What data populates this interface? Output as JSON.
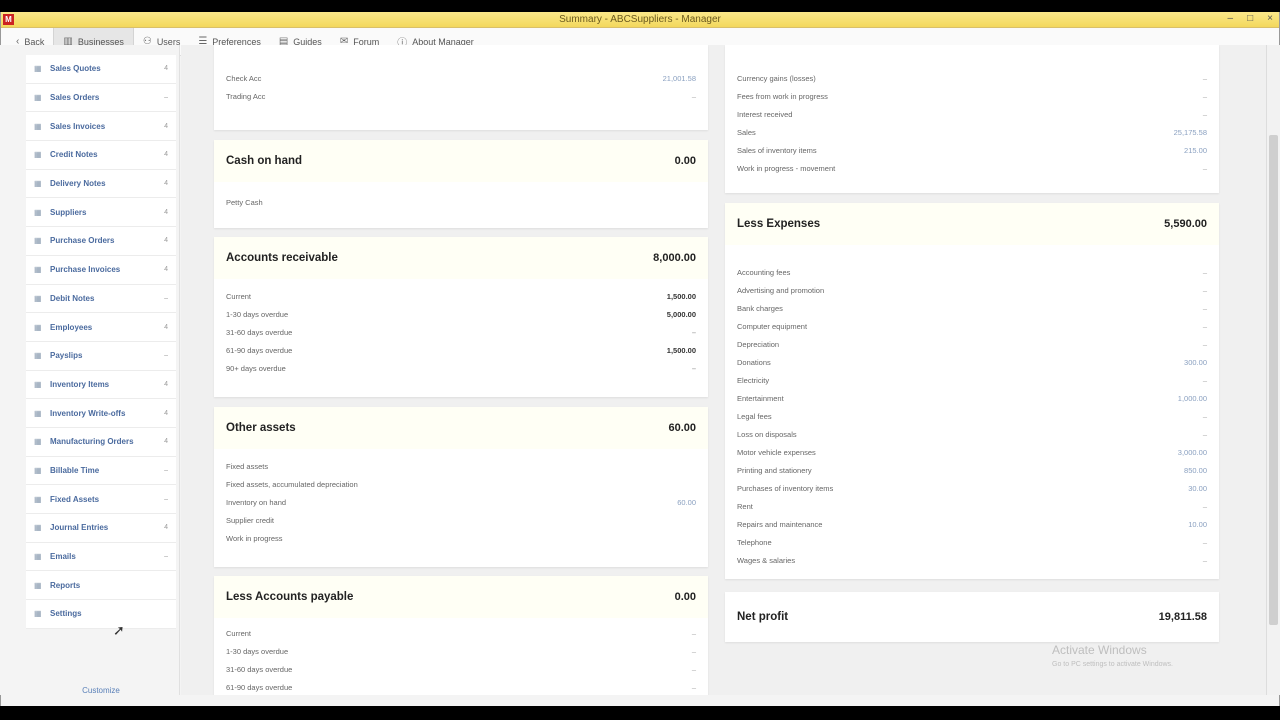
{
  "window": {
    "title": "Summary - ABCSuppliers - Manager",
    "app_icon": "M",
    "controls": [
      "–",
      "□",
      "×"
    ]
  },
  "menu": [
    {
      "icon": "‹",
      "label": "Back"
    },
    {
      "icon": "▥",
      "label": "Businesses",
      "active": true
    },
    {
      "icon": "⚇",
      "label": "Users"
    },
    {
      "icon": "☰",
      "label": "Preferences"
    },
    {
      "icon": "▤",
      "label": "Guides"
    },
    {
      "icon": "✉",
      "label": "Forum"
    },
    {
      "icon": "ⓘ",
      "label": "About Manager"
    }
  ],
  "sidebar": {
    "tabs": [
      {
        "icon": "▦",
        "label": "Sales Quotes",
        "badge": "4"
      },
      {
        "icon": "▦",
        "label": "Sales Orders",
        "badge": "–"
      },
      {
        "icon": "▦",
        "label": "Sales Invoices",
        "badge": "4"
      },
      {
        "icon": "▦",
        "label": "Credit Notes",
        "badge": "4"
      },
      {
        "icon": "▦",
        "label": "Delivery Notes",
        "badge": "4"
      },
      {
        "icon": "▦",
        "label": "Suppliers",
        "badge": "4"
      },
      {
        "icon": "▦",
        "label": "Purchase Orders",
        "badge": "4"
      },
      {
        "icon": "▦",
        "label": "Purchase Invoices",
        "badge": "4"
      },
      {
        "icon": "▦",
        "label": "Debit Notes",
        "badge": "–"
      },
      {
        "icon": "▦",
        "label": "Employees",
        "badge": "4"
      },
      {
        "icon": "▦",
        "label": "Payslips",
        "badge": "–"
      },
      {
        "icon": "▦",
        "label": "Inventory Items",
        "badge": "4"
      },
      {
        "icon": "▦",
        "label": "Inventory Write-offs",
        "badge": "4"
      },
      {
        "icon": "▦",
        "label": "Manufacturing Orders",
        "badge": "4"
      },
      {
        "icon": "▦",
        "label": "Billable Time",
        "badge": "–"
      },
      {
        "icon": "▦",
        "label": "Fixed Assets",
        "badge": "–"
      },
      {
        "icon": "▦",
        "label": "Journal Entries",
        "badge": "4"
      },
      {
        "icon": "▦",
        "label": "Emails",
        "badge": "–"
      },
      {
        "icon": "▦",
        "label": "Reports",
        "badge": ""
      },
      {
        "icon": "▦",
        "label": "Settings",
        "badge": ""
      }
    ],
    "customize_label": "Customize"
  },
  "left_column": {
    "bank": {
      "lines": [
        {
          "label": "Check Acc",
          "amount": "21,001.58"
        },
        {
          "label": "Trading Acc",
          "amount": "–"
        }
      ]
    },
    "cash": {
      "title": "Cash on hand",
      "total": "0.00",
      "lines": [
        {
          "label": "Petty Cash",
          "amount": ""
        }
      ]
    },
    "receivable": {
      "title": "Accounts receivable",
      "total": "8,000.00",
      "lines": [
        {
          "label": "Current",
          "amount": "1,500.00"
        },
        {
          "label": "1-30 days overdue",
          "amount": "5,000.00"
        },
        {
          "label": "31-60 days overdue",
          "amount": "–"
        },
        {
          "label": "61-90 days overdue",
          "amount": "1,500.00"
        },
        {
          "label": "90+ days overdue",
          "amount": "–"
        }
      ]
    },
    "other_assets": {
      "title": "Other assets",
      "total": "60.00",
      "lines": [
        {
          "label": "Fixed assets",
          "amount": ""
        },
        {
          "label": "Fixed assets, accumulated depreciation",
          "amount": ""
        },
        {
          "label": "Inventory on hand",
          "amount": "60.00"
        },
        {
          "label": "Supplier credit",
          "amount": ""
        },
        {
          "label": "Work in progress",
          "amount": ""
        }
      ]
    },
    "payable": {
      "title": "Less Accounts payable",
      "total": "0.00",
      "lines": [
        {
          "label": "Current",
          "amount": "–"
        },
        {
          "label": "1-30 days overdue",
          "amount": "–"
        },
        {
          "label": "31-60 days overdue",
          "amount": "–"
        },
        {
          "label": "61-90 days overdue",
          "amount": "–"
        }
      ]
    }
  },
  "right_column": {
    "income": {
      "lines": [
        {
          "label": "Currency gains (losses)",
          "amount": "–"
        },
        {
          "label": "Fees from work in progress",
          "amount": "–"
        },
        {
          "label": "Interest received",
          "amount": "–"
        },
        {
          "label": "Sales",
          "amount": "25,175.58"
        },
        {
          "label": "Sales of inventory items",
          "amount": "215.00"
        },
        {
          "label": "Work in progress - movement",
          "amount": "–"
        }
      ]
    },
    "expenses": {
      "title": "Less Expenses",
      "total": "5,590.00",
      "lines": [
        {
          "label": "Accounting fees",
          "amount": "–"
        },
        {
          "label": "Advertising and promotion",
          "amount": "–"
        },
        {
          "label": "Bank charges",
          "amount": "–"
        },
        {
          "label": "Computer equipment",
          "amount": "–"
        },
        {
          "label": "Depreciation",
          "amount": "–"
        },
        {
          "label": "Donations",
          "amount": "300.00"
        },
        {
          "label": "Electricity",
          "amount": "–"
        },
        {
          "label": "Entertainment",
          "amount": "1,000.00"
        },
        {
          "label": "Legal fees",
          "amount": "–"
        },
        {
          "label": "Loss on disposals",
          "amount": "–"
        },
        {
          "label": "Motor vehicle expenses",
          "amount": "3,000.00"
        },
        {
          "label": "Printing and stationery",
          "amount": "850.00"
        },
        {
          "label": "Purchases of inventory items",
          "amount": "30.00"
        },
        {
          "label": "Rent",
          "amount": "–"
        },
        {
          "label": "Repairs and maintenance",
          "amount": "10.00"
        },
        {
          "label": "Telephone",
          "amount": "–"
        },
        {
          "label": "Wages & salaries",
          "amount": "–"
        }
      ]
    },
    "net_profit": {
      "title": "Net profit",
      "total": "19,811.58"
    }
  },
  "watermark": {
    "title": "Activate Windows",
    "subtitle": "Go to PC settings to activate Windows."
  }
}
